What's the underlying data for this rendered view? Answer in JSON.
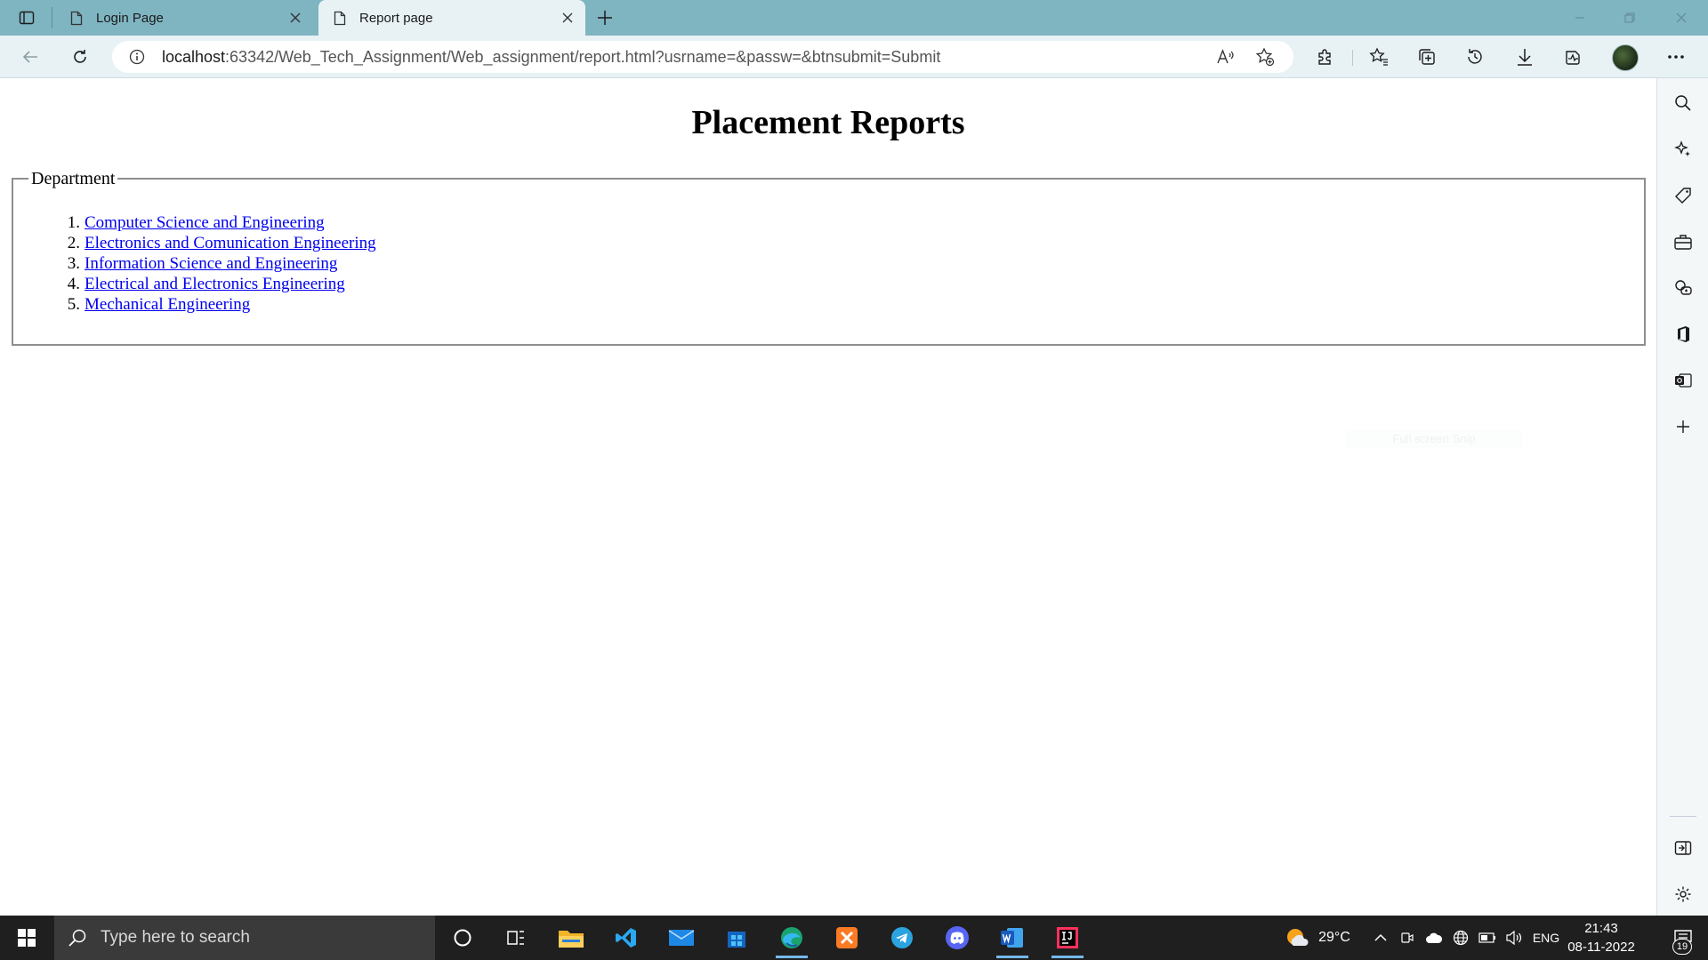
{
  "browser": {
    "tabs": [
      {
        "title": "Login Page",
        "active": false
      },
      {
        "title": "Report page",
        "active": true
      }
    ],
    "url_host": "localhost",
    "url_rest": ":63342/Web_Tech_Assignment/Web_assignment/report.html?usrname=&passw=&btnsubmit=Submit",
    "profile_avatar": "user-avatar"
  },
  "page": {
    "heading": "Placement Reports",
    "fieldset_legend": "Department",
    "departments": [
      {
        "num": "1.",
        "label": "Computer Science and Engineering"
      },
      {
        "num": "2.",
        "label": "Electronics and Comunication Engineering"
      },
      {
        "num": "3.",
        "label": "Information Science and Engineering"
      },
      {
        "num": "4.",
        "label": "Electrical and Electronics Engineering"
      },
      {
        "num": "5.",
        "label": "Mechanical Engineering"
      }
    ],
    "faint_overlay_text": "Full screen Snip"
  },
  "taskbar": {
    "search_placeholder": "Type here to search",
    "weather": "29°C",
    "language": "ENG",
    "time": "21:43",
    "date": "08-11-2022",
    "notification_count": "19",
    "apps": [
      "cortana-icon",
      "task-view-icon",
      "file-explorer-icon",
      "vscode-icon",
      "mail-icon",
      "store-icon",
      "edge-icon",
      "xampp-icon",
      "telegram-icon",
      "discord-icon",
      "word-icon",
      "intellij-icon"
    ]
  },
  "colors": {
    "titlebar": "#7fb4c1",
    "navbar": "#e8f2f5",
    "link": "#0000ee",
    "taskbar": "#1f1f1f"
  }
}
